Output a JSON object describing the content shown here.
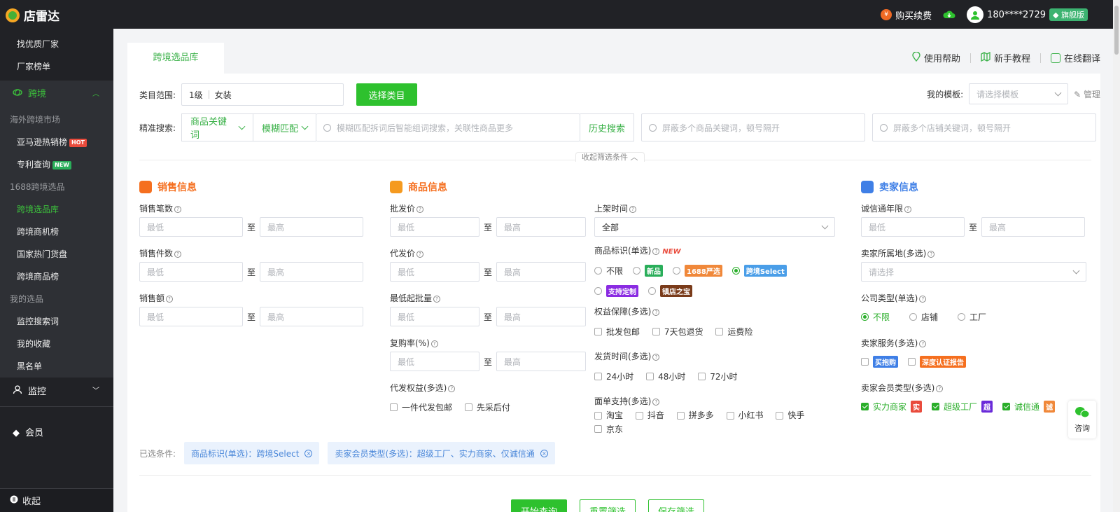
{
  "topbar": {
    "app_name": "店雷达",
    "buy_label": "购买续费",
    "user_phone": "180****2729",
    "user_badge": "旗舰版"
  },
  "sidebar": {
    "top_items": [
      "找优质厂家",
      "厂家榜单"
    ],
    "cross_border_group": "跨境",
    "overseas_head": "海外跨境市场",
    "amazon_item": "亚马逊热销榜",
    "amazon_tag": "HOT",
    "patent_item": "专利查询",
    "patent_tag": "NEW",
    "head_1688": "1688跨境选品",
    "items_1688": [
      "跨境选品库",
      "跨境商机榜",
      "国家热门货盘",
      "跨境商品榜"
    ],
    "my_head": "我的选品",
    "my_items": [
      "监控搜索词",
      "我的收藏",
      "黑名单"
    ],
    "monitor_group": "监控",
    "member_label": "会员",
    "bottom_label": "收起"
  },
  "tabs": {
    "active": "跨境选品库",
    "help": "使用帮助",
    "tutorial": "新手教程",
    "translate": "在线翻译"
  },
  "filters": {
    "category_label": "类目范围:",
    "category_level": "1级",
    "category_value": "女装",
    "category_btn": "选择类目",
    "template_label": "我的模板:",
    "template_placeholder": "请选择模板",
    "manage_label": "管理",
    "search_label": "精准搜索:",
    "keyword_type": "商品关键词",
    "match_type": "模糊匹配",
    "search_placeholder": "模糊匹配拆词后智能组词搜索，关联性商品更多",
    "history_btn": "历史搜索",
    "block_kw_placeholder": "屏蔽多个商品关键词，顿号隔开",
    "block_shop_placeholder": "屏蔽多个店铺关键词，顿号隔开",
    "collapse_label": "收起筛选条件"
  },
  "common": {
    "min_ph": "最低",
    "max_ph": "最高",
    "to": "至",
    "select_ph": "请选择"
  },
  "sales": {
    "title": "销售信息",
    "f1": "销售笔数",
    "f2": "销售件数",
    "f3": "销售额"
  },
  "product": {
    "title": "商品信息",
    "f1": "批发价",
    "f2": "代发价",
    "f3": "最低起批量",
    "f4": "复购率(%)",
    "f5": "代发权益(多选)",
    "f5_opts": [
      "一件代发包邮",
      "先采后付"
    ],
    "list_time": "上架时间",
    "list_time_value": "全部",
    "mark_label": "商品标识(单选)",
    "mark_new": "NEW",
    "mark_opts": [
      "不限",
      "新品",
      "1688严选",
      "跨境Select",
      "支持定制",
      "镇店之宝"
    ],
    "rights_label": "权益保障(多选)",
    "rights_opts": [
      "批发包邮",
      "7天包退货",
      "运费险"
    ],
    "ship_label": "发货时间(多选)",
    "ship_opts": [
      "24小时",
      "48小时",
      "72小时"
    ],
    "waybill_label": "面单支持(多选)",
    "waybill_opts": [
      "淘宝",
      "抖音",
      "拼多多",
      "小红书",
      "快手",
      "京东"
    ]
  },
  "seller": {
    "title": "卖家信息",
    "f1": "诚信通年限",
    "loc_label": "卖家所属地(多选)",
    "company_label": "公司类型(单选)",
    "company_opts": [
      "不限",
      "店铺",
      "工厂"
    ],
    "service_label": "卖家服务(多选)",
    "service_opts": [
      "买抱购",
      "深度认证报告"
    ],
    "member_label": "卖家会员类型(多选)",
    "member_opts": [
      "实力商家",
      "超级工厂",
      "诚信通"
    ]
  },
  "selected": {
    "label": "已选条件:",
    "chip1": "商品标识(单选)：跨境Select",
    "chip2": "卖家会员类型(多选)：超级工厂、实力商家、仅诚信通"
  },
  "actions": {
    "query": "开始查询",
    "reset": "重置筛选",
    "save": "保存筛选"
  },
  "consult_label": "咨询",
  "colors": {
    "accent": "#2ec12e",
    "dark": "#212226",
    "orange": "#f56f1f",
    "blue": "#3f7fe6"
  }
}
